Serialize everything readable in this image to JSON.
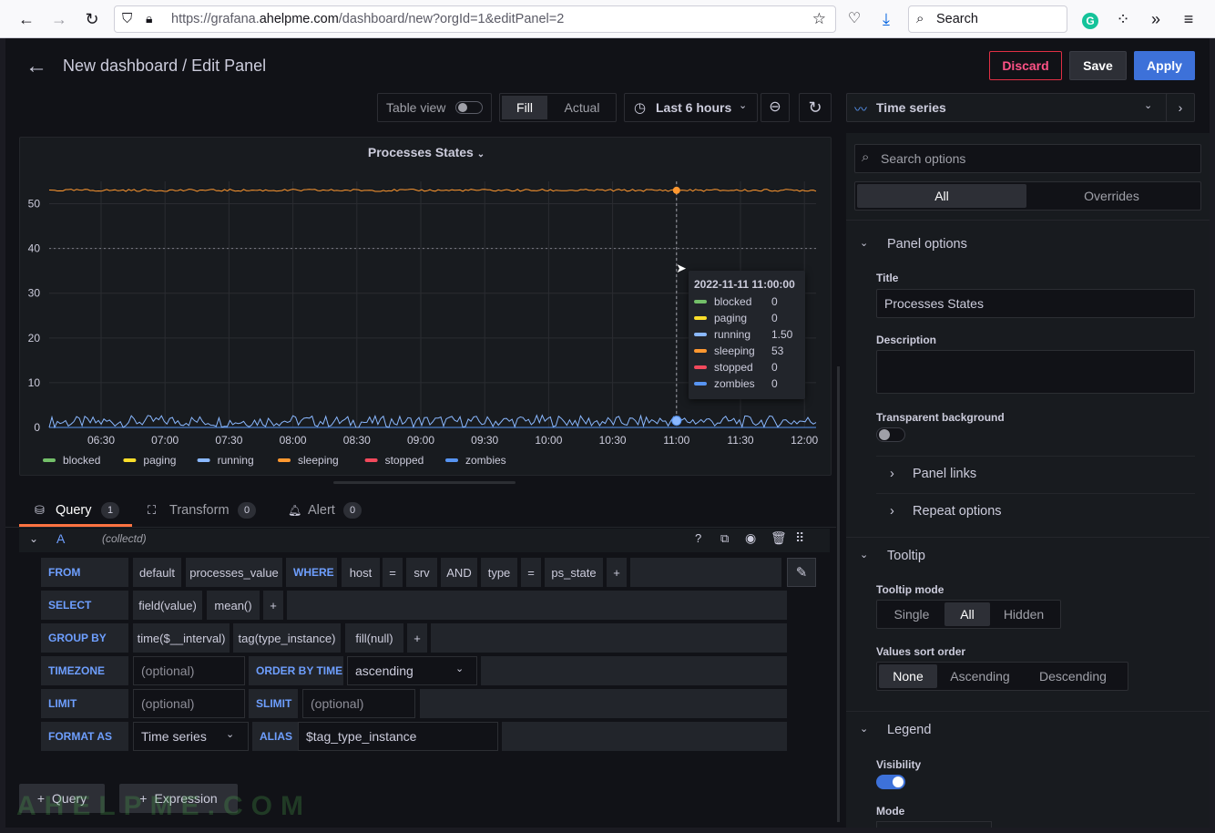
{
  "browser": {
    "url_prefix": "https://grafana.",
    "url_domain": "ahelpme.com",
    "url_path": "/dashboard/new?orgId=1&editPanel=2",
    "search_placeholder": "Search"
  },
  "header": {
    "title": "New dashboard / Edit Panel",
    "discard_label": "Discard",
    "save_label": "Save",
    "apply_label": "Apply"
  },
  "toolbar": {
    "table_view_label": "Table view",
    "fill_label": "Fill",
    "actual_label": "Actual",
    "time_range_label": "Last 6 hours",
    "visualization_label": "Time series"
  },
  "panel": {
    "title": "Processes States",
    "legend": [
      "blocked",
      "paging",
      "running",
      "sleeping",
      "stopped",
      "zombies"
    ],
    "tooltip": {
      "time": "2022-11-11 11:00:00",
      "rows": [
        {
          "name": "blocked",
          "value": "0"
        },
        {
          "name": "paging",
          "value": "0"
        },
        {
          "name": "running",
          "value": "1.50"
        },
        {
          "name": "sleeping",
          "value": "53"
        },
        {
          "name": "stopped",
          "value": "0"
        },
        {
          "name": "zombies",
          "value": "0"
        }
      ]
    }
  },
  "chart_data": {
    "type": "line",
    "title": "Processes States",
    "x": [
      "06:30",
      "07:00",
      "07:30",
      "08:00",
      "08:30",
      "09:00",
      "09:30",
      "10:00",
      "10:30",
      "11:00",
      "11:30",
      "12:00"
    ],
    "ylim": [
      0,
      55
    ],
    "yticks": [
      0,
      10,
      20,
      30,
      40,
      50
    ],
    "threshold_line": 40,
    "series": [
      {
        "name": "blocked",
        "color": "#73bf69",
        "values": [
          0,
          0,
          0,
          0,
          0,
          0,
          0,
          0,
          0,
          0,
          0,
          0
        ]
      },
      {
        "name": "paging",
        "color": "#fade2a",
        "values": [
          0,
          0,
          0,
          0,
          0,
          0,
          0,
          0,
          0,
          0,
          0,
          0
        ]
      },
      {
        "name": "running",
        "color": "#8ab8ff",
        "values": [
          1.2,
          1.5,
          1.3,
          1.5,
          1.2,
          1.4,
          1.3,
          1.5,
          1.2,
          1.5,
          1.3,
          1.4
        ]
      },
      {
        "name": "sleeping",
        "color": "#ff9830",
        "values": [
          53,
          53,
          53,
          53,
          53,
          53,
          53,
          53,
          53,
          53,
          53,
          53
        ]
      },
      {
        "name": "stopped",
        "color": "#f2495c",
        "values": [
          0,
          0,
          0,
          0,
          0,
          0,
          0,
          0,
          0,
          0,
          0,
          0
        ]
      },
      {
        "name": "zombies",
        "color": "#5794f2",
        "values": [
          0,
          0,
          0,
          0,
          0,
          0,
          0,
          0,
          0,
          0,
          0,
          0
        ]
      }
    ],
    "legend_position": "bottom",
    "grid": true
  },
  "query_tabs": {
    "query_label": "Query",
    "query_count": "1",
    "transform_label": "Transform",
    "transform_count": "0",
    "alert_label": "Alert",
    "alert_count": "0"
  },
  "query": {
    "ref": "A",
    "datasource": "(collectd)",
    "from_kw": "FROM",
    "from_db": "default",
    "from_measure": "processes_value",
    "where_kw": "WHERE",
    "w_host": "host",
    "w_eq1": "=",
    "w_srv": "srv",
    "w_and": "AND",
    "w_type": "type",
    "w_eq2": "=",
    "w_val": "ps_state",
    "plus": "+",
    "select_kw": "SELECT",
    "select_field": "field(value)",
    "select_fn": "mean()",
    "group_kw": "GROUP BY",
    "group_time": "time($__interval)",
    "group_tag": "tag(type_instance)",
    "group_fill": "fill(null)",
    "timezone_kw": "TIMEZONE",
    "timezone_placeholder": "(optional)",
    "order_kw": "ORDER BY TIME",
    "order_value": "ascending",
    "limit_kw": "LIMIT",
    "limit_placeholder": "(optional)",
    "slimit_kw": "SLIMIT",
    "slimit_placeholder": "(optional)",
    "format_kw": "FORMAT AS",
    "format_value": "Time series",
    "alias_kw": "ALIAS",
    "alias_value": "$tag_type_instance"
  },
  "bottom": {
    "add_query_label": "Query",
    "add_expression_label": "Expression",
    "watermark": "AHELPME.COM"
  },
  "options": {
    "search_placeholder": "Search options",
    "tab_all": "All",
    "tab_overrides": "Overrides",
    "panel_options_label": "Panel options",
    "title_label": "Title",
    "title_value": "Processes States",
    "description_label": "Description",
    "transparent_label": "Transparent background",
    "panel_links_label": "Panel links",
    "repeat_options_label": "Repeat options",
    "tooltip_label": "Tooltip",
    "tooltip_mode_label": "Tooltip mode",
    "tooltip_modes": [
      "Single",
      "All",
      "Hidden"
    ],
    "sort_order_label": "Values sort order",
    "sort_orders": [
      "None",
      "Ascending",
      "Descending"
    ],
    "legend_label": "Legend",
    "visibility_label": "Visibility",
    "mode_label": "Mode"
  }
}
